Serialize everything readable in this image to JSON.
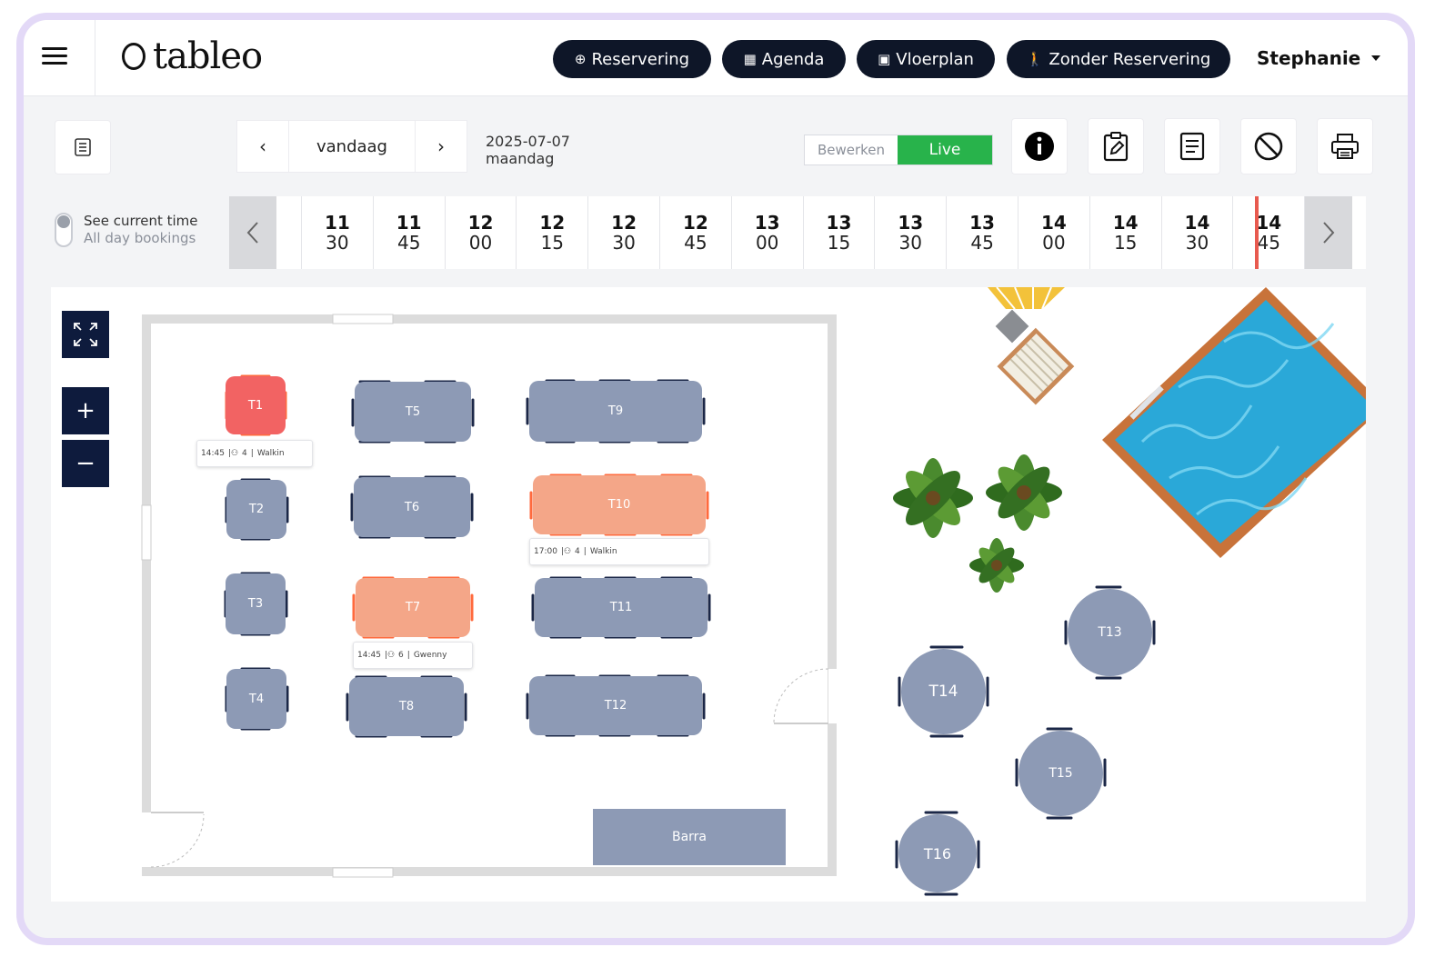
{
  "header": {
    "logo_text": "tableo",
    "nav": [
      {
        "icon": "⊕",
        "label": "Reservering"
      },
      {
        "icon": "▦",
        "label": "Agenda"
      },
      {
        "icon": "▣",
        "label": "Vloerplan"
      },
      {
        "icon": "🚶",
        "label": "Zonder Reservering"
      }
    ],
    "user": "Stephanie"
  },
  "toolbar": {
    "prev": "‹",
    "today": "vandaag",
    "next": "›",
    "date": "2025-07-07",
    "weekday": "maandag",
    "mode_edit": "Bewerken",
    "mode_live": "Live"
  },
  "timeline": {
    "see_current": "See current time",
    "all_day": "All day bookings",
    "slots": [
      {
        "h": "11",
        "m": "30"
      },
      {
        "h": "11",
        "m": "45"
      },
      {
        "h": "12",
        "m": "00"
      },
      {
        "h": "12",
        "m": "15"
      },
      {
        "h": "12",
        "m": "30"
      },
      {
        "h": "12",
        "m": "45"
      },
      {
        "h": "13",
        "m": "00"
      },
      {
        "h": "13",
        "m": "15"
      },
      {
        "h": "13",
        "m": "30"
      },
      {
        "h": "13",
        "m": "45"
      },
      {
        "h": "14",
        "m": "00"
      },
      {
        "h": "14",
        "m": "15"
      },
      {
        "h": "14",
        "m": "30"
      },
      {
        "h": "14",
        "m": "45"
      }
    ]
  },
  "floor": {
    "zoom_in": "+",
    "zoom_out": "−",
    "tables": {
      "t1": "T1",
      "t2": "T2",
      "t3": "T3",
      "t4": "T4",
      "t5": "T5",
      "t6": "T6",
      "t7": "T7",
      "t8": "T8",
      "t9": "T9",
      "t10": "T10",
      "t11": "T11",
      "t12": "T12",
      "t13": "T13",
      "t14": "T14",
      "t15": "T15",
      "t16": "T16"
    },
    "bookings": {
      "t1": {
        "time": "14:45",
        "guests": "4",
        "name": "Walkin"
      },
      "t10": {
        "time": "17:00",
        "guests": "4",
        "name": "Walkin"
      },
      "t7": {
        "time": "14:45",
        "guests": "6",
        "name": "Gwenny"
      }
    },
    "barra": "Barra"
  },
  "colors": {
    "navy": "#0e1628",
    "table_free": "#8d9ab5",
    "table_reserved": "#f4a688",
    "table_occupied": "#f26363",
    "live_green": "#28b34b",
    "now_line": "#e85a4f"
  }
}
